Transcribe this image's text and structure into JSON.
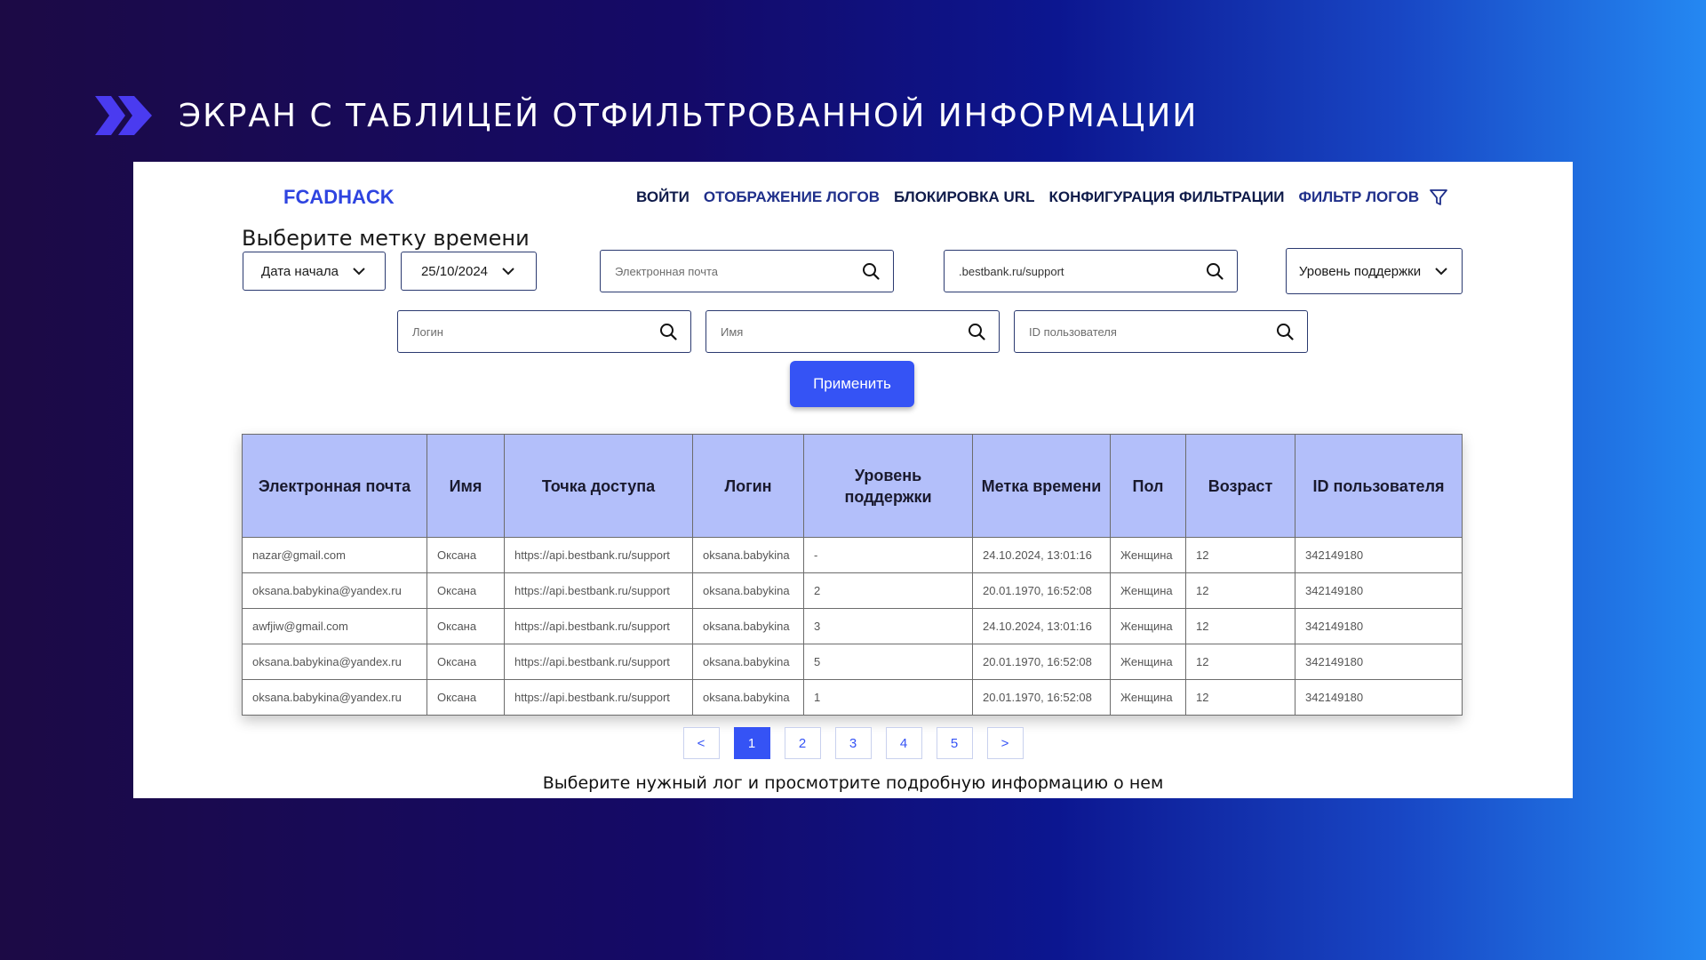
{
  "slide": {
    "title": "ЭКРАН С ТАБЛИЦЕЙ ОТФИЛЬТРОВАННОЙ ИНФОРМАЦИИ",
    "chevron_color": "#4a3bf0"
  },
  "app": {
    "logo": "FCADHACK",
    "nav": {
      "login": "ВОЙТИ",
      "logs_view": "ОТОБРАЖЕНИЕ ЛОГОВ",
      "url_block": "БЛОКИРОВКА URL",
      "filter_config": "КОНФИГУРАЦИЯ ФИЛЬТРАЦИИ",
      "log_filter": "ФИЛЬТР ЛОГОВ"
    },
    "accent_color": "#3553f5"
  },
  "filters": {
    "time_label": "Выберите метку времени",
    "start_date": "Дата начала",
    "date_value": "25/10/2024",
    "email_placeholder": "Электронная почта",
    "url_value": ".bestbank.ru/support",
    "support_level": "Уровень поддержки",
    "login_placeholder": "Логин",
    "name_placeholder": "Имя",
    "user_id_placeholder": "ID пользователя",
    "apply_label": "Применить"
  },
  "table": {
    "headers": {
      "email": "Электронная почта",
      "name": "Имя",
      "access_point": "Точка доступа",
      "login": "Логин",
      "support_level": "Уровень поддержки",
      "timestamp": "Метка времени",
      "gender": "Пол",
      "age": "Возраст",
      "user_id": "ID пользователя"
    },
    "rows": [
      {
        "email": "nazar@gmail.com",
        "name": "Оксана",
        "access_point": "https://api.bestbank.ru/support",
        "login": "oksana.babykina",
        "support_level": "-",
        "timestamp": "24.10.2024, 13:01:16",
        "gender": "Женщина",
        "age": "12",
        "user_id": "342149180"
      },
      {
        "email": "oksana.babykina@yandex.ru",
        "name": "Оксана",
        "access_point": "https://api.bestbank.ru/support",
        "login": "oksana.babykina",
        "support_level": "2",
        "timestamp": "20.01.1970, 16:52:08",
        "gender": "Женщина",
        "age": "12",
        "user_id": "342149180"
      },
      {
        "email": "awfjiw@gmail.com",
        "name": "Оксана",
        "access_point": "https://api.bestbank.ru/support",
        "login": "oksana.babykina",
        "support_level": "3",
        "timestamp": "24.10.2024, 13:01:16",
        "gender": "Женщина",
        "age": "12",
        "user_id": "342149180"
      },
      {
        "email": "oksana.babykina@yandex.ru",
        "name": "Оксана",
        "access_point": "https://api.bestbank.ru/support",
        "login": "oksana.babykina",
        "support_level": "5",
        "timestamp": "20.01.1970, 16:52:08",
        "gender": "Женщина",
        "age": "12",
        "user_id": "342149180"
      },
      {
        "email": "oksana.babykina@yandex.ru",
        "name": "Оксана",
        "access_point": "https://api.bestbank.ru/support",
        "login": "oksana.babykina",
        "support_level": "1",
        "timestamp": "20.01.1970, 16:52:08",
        "gender": "Женщина",
        "age": "12",
        "user_id": "342149180"
      }
    ]
  },
  "pagination": {
    "prev": "<",
    "pages": [
      "1",
      "2",
      "3",
      "4",
      "5"
    ],
    "next": ">",
    "current": "1"
  },
  "hint": "Выберите нужный лог и просмотрите подробную информацию о нем"
}
